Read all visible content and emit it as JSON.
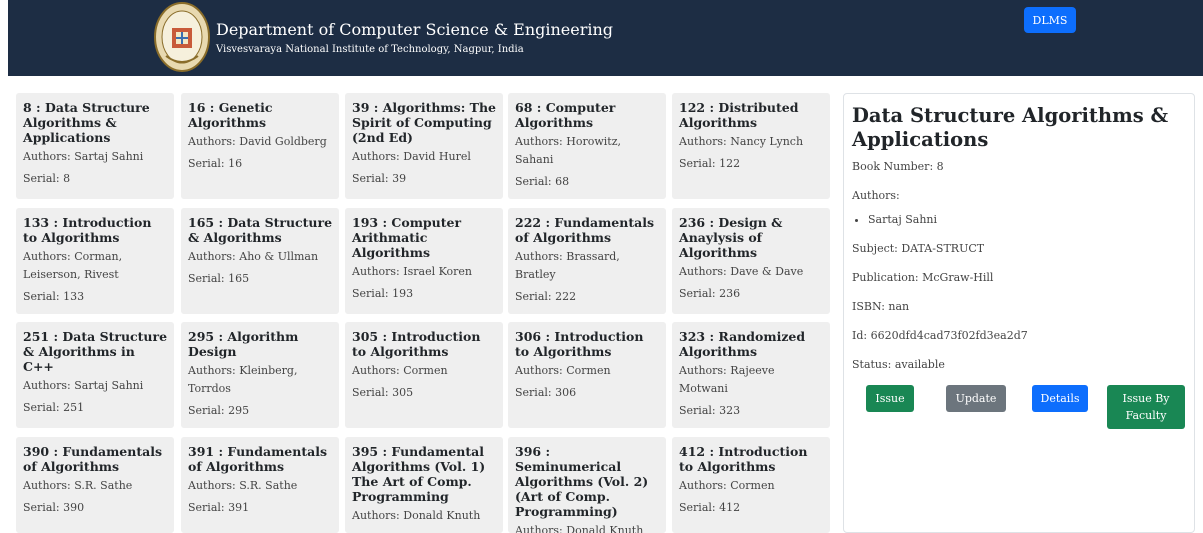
{
  "header": {
    "title": "Department of Computer Science & Engineering",
    "subtitle": "Visvesvaraya National Institute of Technology, Nagpur, India",
    "dlms_label": "DLMS"
  },
  "books": [
    {
      "title": "8 : Data Structure Algorithms & Applications",
      "authors": "Authors: Sartaj Sahni",
      "serial": "Serial: 8"
    },
    {
      "title": "16 : Genetic Algorithms",
      "authors": "Authors: David Goldberg",
      "serial": "Serial: 16"
    },
    {
      "title": "39 : Algorithms: The Spirit of Computing (2nd Ed)",
      "authors": "Authors: David Hurel",
      "serial": "Serial: 39"
    },
    {
      "title": "68 : Computer Algorithms",
      "authors": "Authors: Horowitz, Sahani",
      "serial": "Serial: 68"
    },
    {
      "title": "122 : Distributed Algorithms",
      "authors": "Authors: Nancy Lynch",
      "serial": "Serial: 122"
    },
    {
      "title": "133 : Introduction to Algorithms",
      "authors": "Authors: Corman, Leiserson, Rivest",
      "serial": "Serial: 133"
    },
    {
      "title": "165 : Data Structure & Algorithms",
      "authors": "Authors: Aho & Ullman",
      "serial": "Serial: 165"
    },
    {
      "title": "193 : Computer Arithmatic Algorithms",
      "authors": "Authors: Israel Koren",
      "serial": "Serial: 193"
    },
    {
      "title": "222 : Fundamentals of Algorithms",
      "authors": "Authors: Brassard, Bratley",
      "serial": "Serial: 222"
    },
    {
      "title": "236 : Design & Anaylysis of Algorithms",
      "authors": "Authors: Dave & Dave",
      "serial": "Serial: 236"
    },
    {
      "title": "251 : Data Structure & Algorithms in C++",
      "authors": "Authors: Sartaj Sahni",
      "serial": "Serial: 251"
    },
    {
      "title": "295 : Algorithm Design",
      "authors": "Authors: Kleinberg, Torrdos",
      "serial": "Serial: 295"
    },
    {
      "title": "305 : Introduction to Algorithms",
      "authors": "Authors: Cormen",
      "serial": "Serial: 305"
    },
    {
      "title": "306 : Introduction to Algorithms",
      "authors": "Authors: Cormen",
      "serial": "Serial: 306"
    },
    {
      "title": "323 : Randomized Algorithms",
      "authors": "Authors: Rajeeve Motwani",
      "serial": "Serial: 323"
    },
    {
      "title": "390 : Fundamentals of Algorithms",
      "authors": "Authors: S.R. Sathe",
      "serial": "Serial: 390"
    },
    {
      "title": "391 : Fundamentals of Algorithms",
      "authors": "Authors: S.R. Sathe",
      "serial": "Serial: 391"
    },
    {
      "title": "395 : Fundamental Algorithms (Vol. 1) The Art of Comp. Programming",
      "authors": "Authors: Donald Knuth",
      "serial": ""
    },
    {
      "title": "396 : Seminumerical Algorithms (Vol. 2) (Art of Comp. Programming)",
      "authors": "Authors: Donald Knuth",
      "serial": ""
    },
    {
      "title": "412 : Introduction to Algorithms",
      "authors": "Authors: Cormen",
      "serial": "Serial: 412"
    }
  ],
  "detail": {
    "title": "Data Structure Algorithms & Applications",
    "book_number": "Book Number: 8",
    "authors_label": "Authors:",
    "authors": [
      "Sartaj Sahni"
    ],
    "subject": "Subject: DATA-STRUCT",
    "publication": "Publication: McGraw-Hill",
    "isbn": "ISBN: nan",
    "id": "Id: 6620dfd4cad73f02fd3ea2d7",
    "status": "Status: available"
  },
  "actions": {
    "issue": "Issue",
    "update": "Update",
    "details": "Details",
    "issue_faculty": "Issue By Faculty"
  },
  "colors": {
    "header_bg": "#1d2d44",
    "primary": "#0d6efd",
    "success": "#198754",
    "secondary": "#6c757d",
    "card_bg": "#efefef"
  }
}
